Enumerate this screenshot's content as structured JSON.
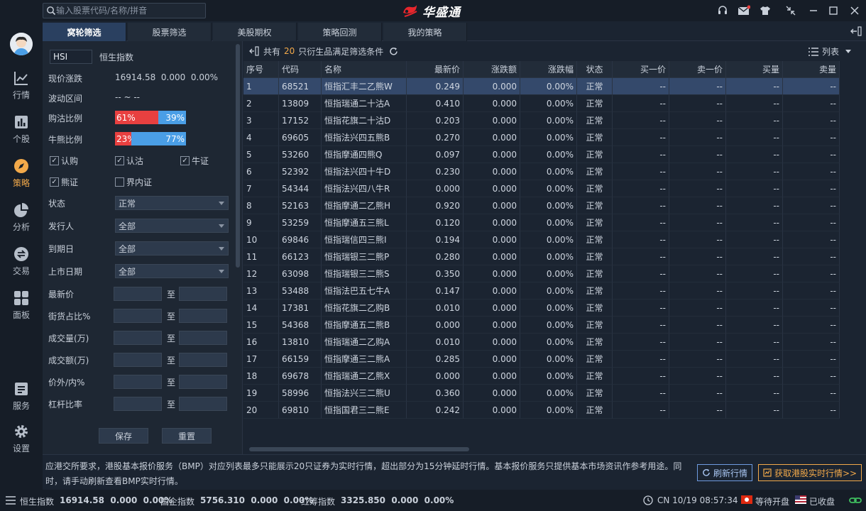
{
  "search": {
    "placeholder": "输入股票代码/名称/拼音"
  },
  "brand": {
    "name": "华盛通"
  },
  "nav": [
    {
      "label": "行情",
      "icon": "line-chart-icon"
    },
    {
      "label": "个股",
      "icon": "bar-chart-icon"
    },
    {
      "label": "策略",
      "icon": "compass-icon"
    },
    {
      "label": "分析",
      "icon": "pie-chart-icon"
    },
    {
      "label": "交易",
      "icon": "trade-icon"
    },
    {
      "label": "面板",
      "icon": "grid-icon"
    },
    {
      "label": "服务",
      "icon": "document-icon"
    },
    {
      "label": "设置",
      "icon": "gear-icon"
    }
  ],
  "tabs": [
    "窝轮筛选",
    "股票筛选",
    "美股期权",
    "策略回测",
    "我的策略"
  ],
  "filter": {
    "code": "HSI",
    "name": "恒生指数",
    "price_label": "现价涨跌",
    "price_value": "16914.58  0.000  0.00%",
    "range_label": "波动区间",
    "range_value": "-- ~ --",
    "put_call_label": "购沽比例",
    "put_call": {
      "left": "61%",
      "right": "39%",
      "left_pct": 61
    },
    "bull_bear_label": "牛熊比例",
    "bull_bear": {
      "left": "23%",
      "right": "77%",
      "left_pct": 23
    },
    "checks": [
      {
        "label": "认购",
        "checked": true
      },
      {
        "label": "认沽",
        "checked": true
      },
      {
        "label": "牛证",
        "checked": true
      },
      {
        "label": "熊证",
        "checked": true
      },
      {
        "label": "界内证",
        "checked": false
      }
    ],
    "selects": [
      {
        "label": "状态",
        "value": "正常"
      },
      {
        "label": "发行人",
        "value": "全部"
      },
      {
        "label": "到期日",
        "value": "全部"
      },
      {
        "label": "上市日期",
        "value": "全部"
      }
    ],
    "ranges": [
      "最新价",
      "街货占比%",
      "成交量(万)",
      "成交额(万)",
      "价外/内%",
      "杠杆比率"
    ],
    "to": "至",
    "save": "保存",
    "reset": "重置"
  },
  "results": {
    "prefix": "共有",
    "count": "20",
    "suffix": "只衍生品满足筛选条件",
    "view": "列表",
    "columns": [
      "序号",
      "代码",
      "名称",
      "最新价",
      "涨跌额",
      "涨跌幅",
      "状态",
      "买一价",
      "卖一价",
      "买量",
      "卖量"
    ],
    "rows": [
      [
        "1",
        "68521",
        "恒指汇丰二乙熊W",
        "0.249",
        "0.000",
        "0.00%",
        "正常",
        "--",
        "--",
        "--",
        "--"
      ],
      [
        "2",
        "13809",
        "恒指瑞通二十沽A",
        "0.410",
        "0.000",
        "0.00%",
        "正常",
        "--",
        "--",
        "--",
        "--"
      ],
      [
        "3",
        "17152",
        "恒指花旗二十沽D",
        "0.203",
        "0.000",
        "0.00%",
        "正常",
        "--",
        "--",
        "--",
        "--"
      ],
      [
        "4",
        "69605",
        "恒指法兴四五熊B",
        "0.270",
        "0.000",
        "0.00%",
        "正常",
        "--",
        "--",
        "--",
        "--"
      ],
      [
        "5",
        "53260",
        "恒指摩通四熊Q",
        "0.097",
        "0.000",
        "0.00%",
        "正常",
        "--",
        "--",
        "--",
        "--"
      ],
      [
        "6",
        "52392",
        "恒指法兴四十牛D",
        "0.230",
        "0.000",
        "0.00%",
        "正常",
        "--",
        "--",
        "--",
        "--"
      ],
      [
        "7",
        "54344",
        "恒指法兴四八牛R",
        "0.000",
        "0.000",
        "0.00%",
        "正常",
        "--",
        "--",
        "--",
        "--"
      ],
      [
        "8",
        "52163",
        "恒指摩通二乙熊H",
        "0.920",
        "0.000",
        "0.00%",
        "正常",
        "--",
        "--",
        "--",
        "--"
      ],
      [
        "9",
        "53259",
        "恒指摩通五三熊L",
        "0.120",
        "0.000",
        "0.00%",
        "正常",
        "--",
        "--",
        "--",
        "--"
      ],
      [
        "10",
        "69846",
        "恒指瑞信四三熊I",
        "0.194",
        "0.000",
        "0.00%",
        "正常",
        "--",
        "--",
        "--",
        "--"
      ],
      [
        "11",
        "66123",
        "恒指瑞银三二熊P",
        "0.280",
        "0.000",
        "0.00%",
        "正常",
        "--",
        "--",
        "--",
        "--"
      ],
      [
        "12",
        "63098",
        "恒指瑞银三二熊S",
        "0.350",
        "0.000",
        "0.00%",
        "正常",
        "--",
        "--",
        "--",
        "--"
      ],
      [
        "13",
        "53488",
        "恒指法巴五七牛A",
        "0.147",
        "0.000",
        "0.00%",
        "正常",
        "--",
        "--",
        "--",
        "--"
      ],
      [
        "14",
        "17381",
        "恒指花旗二乙购B",
        "0.010",
        "0.000",
        "0.00%",
        "正常",
        "--",
        "--",
        "--",
        "--"
      ],
      [
        "15",
        "54368",
        "恒指摩通五二熊B",
        "0.000",
        "0.000",
        "0.00%",
        "正常",
        "--",
        "--",
        "--",
        "--"
      ],
      [
        "16",
        "13810",
        "恒指瑞通二乙购A",
        "0.010",
        "0.000",
        "0.00%",
        "正常",
        "--",
        "--",
        "--",
        "--"
      ],
      [
        "17",
        "66159",
        "恒指摩通三二熊A",
        "0.285",
        "0.000",
        "0.00%",
        "正常",
        "--",
        "--",
        "--",
        "--"
      ],
      [
        "18",
        "69678",
        "恒指瑞通二乙熊X",
        "0.000",
        "0.000",
        "0.00%",
        "正常",
        "--",
        "--",
        "--",
        "--"
      ],
      [
        "19",
        "58996",
        "恒指法兴三二熊U",
        "0.360",
        "0.000",
        "0.00%",
        "正常",
        "--",
        "--",
        "--",
        "--"
      ],
      [
        "20",
        "69810",
        "恒指国君三二熊E",
        "0.242",
        "0.000",
        "0.00%",
        "正常",
        "--",
        "--",
        "--",
        "--"
      ]
    ]
  },
  "notice": {
    "text": "应港交所要求，港股基本报价服务（BMP）对应列表最多只能展示20只证券为实时行情，超出部分为15分钟延时行情。基本报价服务只提供基本市场资讯作参考用途。同时，请手动刷新查看BMP实时行情。",
    "refresh": "刷新行情",
    "get_realtime": "获取港股实时行情>>"
  },
  "status": {
    "idx1_name": "恒生指数",
    "idx1_value": "16914.58  0.000  0.00%",
    "idx2_name": "国企指数",
    "idx2_value": "5756.310  0.000  0.00%",
    "idx3_name": "红筹指数",
    "idx3_value": "3325.850  0.000  0.00%",
    "clock": "CN 10/19 08:57:34",
    "hk_state": "等待开盘",
    "us_state": "已收盘"
  },
  "colors": {
    "accent": "#f2a94a",
    "selected_row": "#34496b",
    "call": "#e84040",
    "put": "#4a9ee6"
  }
}
